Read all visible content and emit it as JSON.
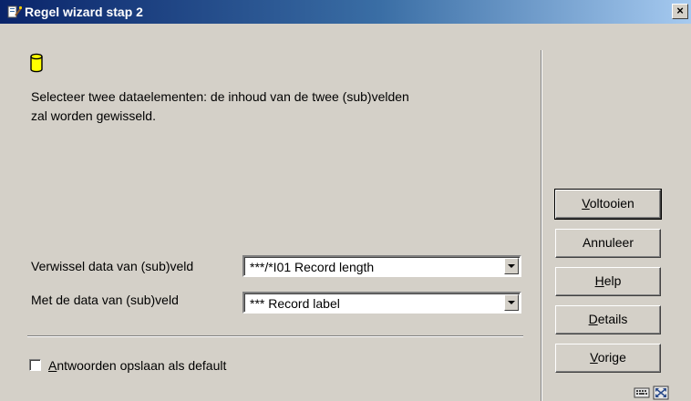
{
  "window": {
    "title": "Regel wizard stap 2",
    "close_glyph": "×",
    "app_icon": "wizard-icon"
  },
  "content": {
    "icon": "database-icon",
    "message_line1": "Selecteer twee dataelementen: de inhoud van de twee (sub)velden",
    "message_line2": "zal worden gewisseld."
  },
  "form": {
    "field1_label": "Verwissel data van (sub)veld",
    "field1_value": "***/*I01 Record length",
    "field2_label": "Met de data van (sub)veld",
    "field2_value": "*** Record label"
  },
  "checkbox": {
    "label_first": "A",
    "label_rest": "ntwoorden opslaan als default",
    "checked": false
  },
  "buttons": {
    "voltooien": {
      "first": "V",
      "rest": "oltooien"
    },
    "annuleer": "Annuleer",
    "help": {
      "first": "H",
      "rest": "elp"
    },
    "details": {
      "first": "D",
      "rest": "etails"
    },
    "vorige": {
      "first": "V",
      "rest": "orige"
    }
  },
  "status_icons": [
    "keyboard-icon",
    "resize-icon"
  ]
}
